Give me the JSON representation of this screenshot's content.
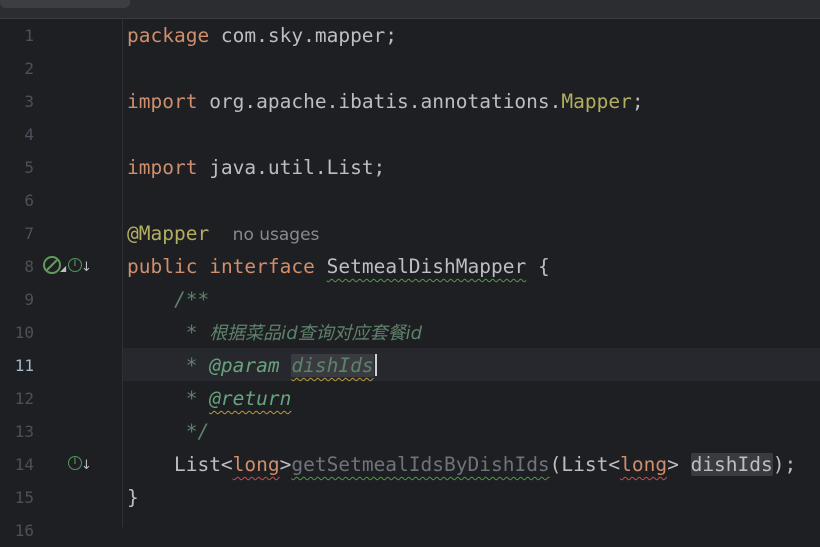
{
  "lines": [
    {
      "num": "1"
    },
    {
      "num": "2"
    },
    {
      "num": "3"
    },
    {
      "num": "4"
    },
    {
      "num": "5"
    },
    {
      "num": "6"
    },
    {
      "num": "7"
    },
    {
      "num": "8"
    },
    {
      "num": "9"
    },
    {
      "num": "10"
    },
    {
      "num": "11"
    },
    {
      "num": "12"
    },
    {
      "num": "13"
    },
    {
      "num": "14"
    },
    {
      "num": "15"
    },
    {
      "num": "16"
    }
  ],
  "code": {
    "l1_kw": "package",
    "l1_rest": " com.sky.mapper;",
    "l3_kw": "import",
    "l3_pkg": " org.apache.ibatis.annotations.",
    "l3_cls": "Mapper",
    "l3_semi": ";",
    "l5_kw": "import",
    "l5_rest": " java.util.List;",
    "l7_ann": "@Mapper",
    "l7_hint": "no usages",
    "l8_kw1": "public",
    "l8_kw2": "interface",
    "l8_name": "SetmealDishMapper",
    "l8_brace": " {",
    "l9_doc": "/**",
    "l10_star": "* ",
    "l10_text": "根据菜品id查询对应套餐id",
    "l11_star": "* ",
    "l11_tag": "@param",
    "l11_param": "dishIds",
    "l12_star": "* ",
    "l12_tag": "@return",
    "l13_end": "*/",
    "l14_list": "List<",
    "l14_long1": "long",
    "l14_gt": ">",
    "l14_method": "getSetmealIdsByDishIds",
    "l14_paren": "(List<",
    "l14_long2": "long",
    "l14_gt2": "> ",
    "l14_param": "dishIds",
    "l14_end": ");",
    "l15_brace": "}"
  },
  "gutter_icons": {
    "l8_no_entry": "no-entry-icon",
    "l8_impl": "implemented-icon",
    "l14_impl": "implemented-icon"
  },
  "colors": {
    "keyword": "#cf8e6d",
    "annotation": "#b3ae60",
    "doc": "#5f826b",
    "method": "#56a8f5"
  }
}
